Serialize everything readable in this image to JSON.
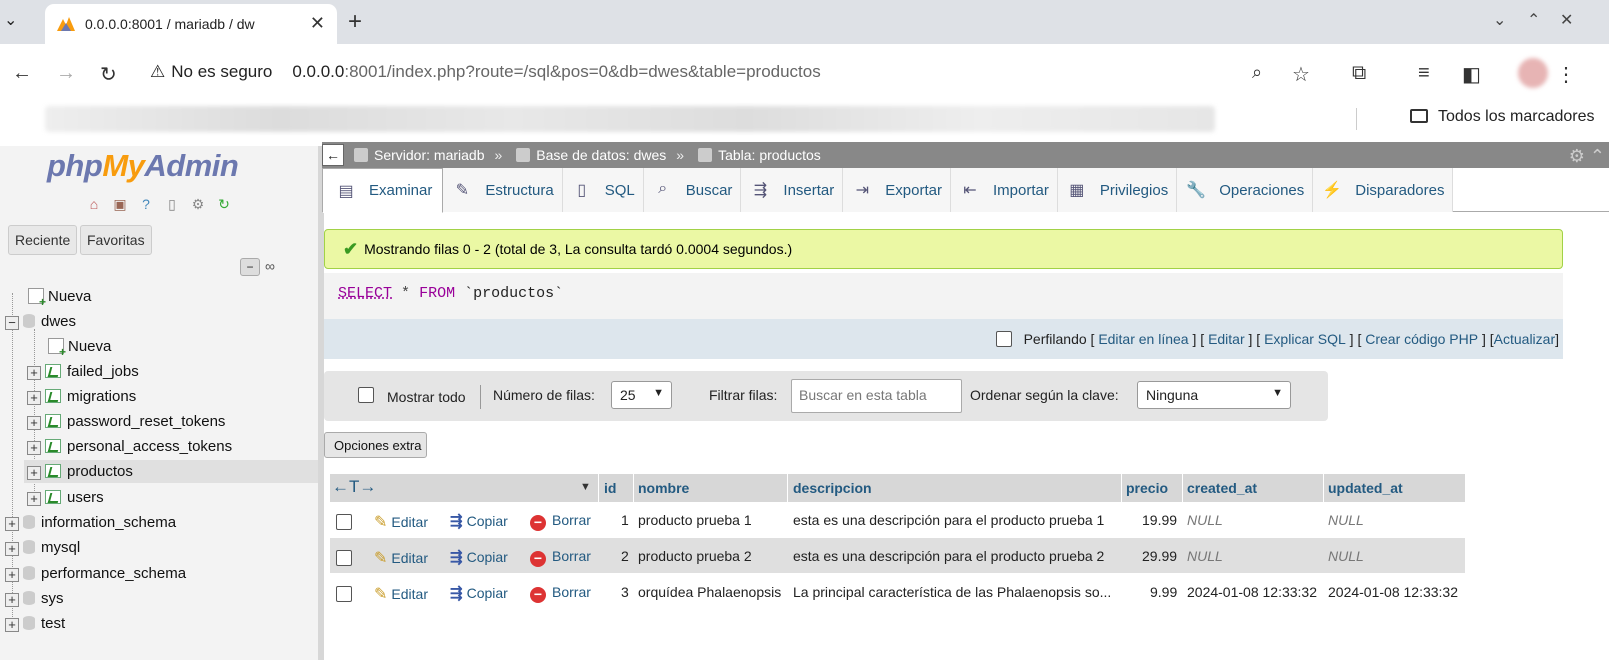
{
  "browser": {
    "tab_title": "0.0.0.0:8001 / mariadb / dw",
    "insecure_label": "No es seguro",
    "url_host": "0.0.0.0",
    "url_rest": ":8001/index.php?route=/sql&pos=0&db=dwes&table=productos",
    "all_bookmarks": "Todos los marcadores"
  },
  "nav": {
    "logo_php": "php",
    "logo_my": "My",
    "logo_admin": "Admin",
    "recent": "Reciente",
    "favorites": "Favoritas",
    "tree": {
      "new_top": "Nueva",
      "dwes": "dwes",
      "new_db": "Nueva",
      "tables": [
        "failed_jobs",
        "migrations",
        "password_reset_tokens",
        "personal_access_tokens",
        "productos",
        "users"
      ],
      "dbs": [
        "information_schema",
        "mysql",
        "performance_schema",
        "sys",
        "test"
      ]
    }
  },
  "breadcrumb": {
    "server": "Servidor: mariadb",
    "database": "Base de datos: dwes",
    "table": "Tabla: productos",
    "sep": "»"
  },
  "tabs": [
    "Examinar",
    "Estructura",
    "SQL",
    "Buscar",
    "Insertar",
    "Exportar",
    "Importar",
    "Privilegios",
    "Operaciones",
    "Disparadores"
  ],
  "success_message": "Mostrando filas 0 - 2 (total de 3, La consulta tardó 0.0004 segundos.)",
  "sql": {
    "select": "SELECT",
    "star": "*",
    "from": "FROM",
    "table": "`productos`"
  },
  "sqlbar": {
    "profiling": "Perfilando",
    "links": [
      "Editar en línea",
      "Editar",
      "Explicar SQL",
      "Crear código PHP",
      "Actualizar"
    ]
  },
  "filter": {
    "show_all": "Mostrar todo",
    "num_rows_label": "Número de filas:",
    "num_rows_value": "25",
    "filter_label": "Filtrar filas:",
    "search_placeholder": "Buscar en esta tabla",
    "sort_label": "Ordenar según la clave:",
    "sort_value": "Ninguna"
  },
  "extra_options": "Opciones extra",
  "table": {
    "columns": [
      "id",
      "nombre",
      "descripcion",
      "precio",
      "created_at",
      "updated_at"
    ],
    "actions": {
      "edit": "Editar",
      "copy": "Copiar",
      "delete": "Borrar"
    },
    "rows": [
      {
        "id": "1",
        "nombre": "producto prueba 1",
        "descripcion": "esta es una descripción para el producto prueba 1",
        "precio": "19.99",
        "created_at": "NULL",
        "updated_at": "NULL"
      },
      {
        "id": "2",
        "nombre": "producto prueba 2",
        "descripcion": "esta es una descripción para el producto prueba 2",
        "precio": "29.99",
        "created_at": "NULL",
        "updated_at": "NULL"
      },
      {
        "id": "3",
        "nombre": "orquídea Phalaenopsis",
        "descripcion": "La principal característica de las Phalaenopsis so...",
        "precio": "9.99",
        "created_at": "2024-01-08 12:33:32",
        "updated_at": "2024-01-08 12:33:32"
      }
    ]
  },
  "colors": {
    "link": "#235a81",
    "success_bg": "#ebf8a4",
    "crumb_bg": "#888888"
  }
}
